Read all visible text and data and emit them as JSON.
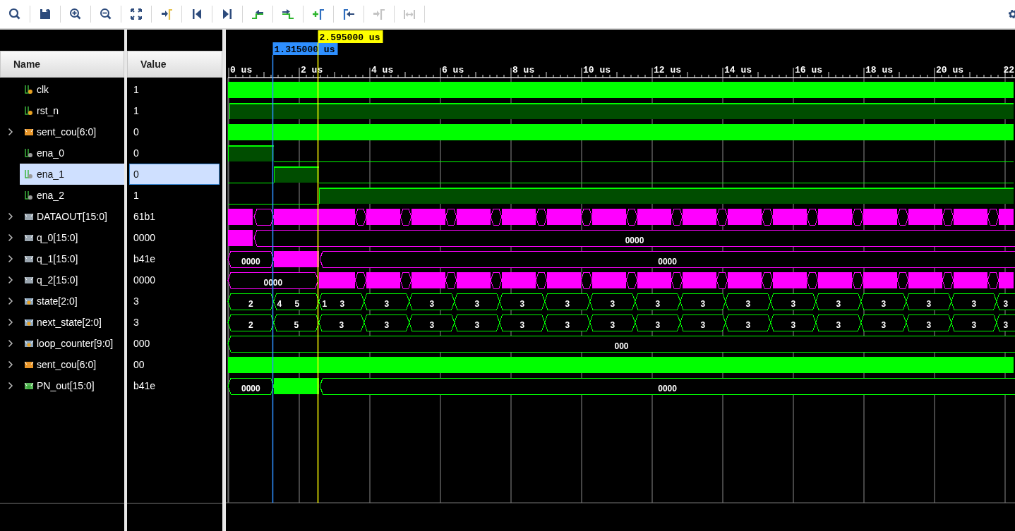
{
  "toolbar": [
    {
      "kind": "search",
      "disabled": false
    },
    {
      "kind": "save",
      "disabled": false
    },
    {
      "kind": "zoom_in",
      "disabled": false
    },
    {
      "kind": "zoom_out",
      "disabled": false
    },
    {
      "kind": "fit",
      "disabled": false
    },
    {
      "kind": "goto_cursor",
      "disabled": false
    },
    {
      "kind": "goto_start",
      "disabled": false
    },
    {
      "kind": "goto_end",
      "disabled": false
    },
    {
      "kind": "prev_transition",
      "disabled": false
    },
    {
      "kind": "next_transition",
      "disabled": false
    },
    {
      "kind": "add_marker",
      "disabled": false
    },
    {
      "kind": "prev_marker",
      "disabled": false
    },
    {
      "kind": "next_marker",
      "disabled": true
    },
    {
      "kind": "swap_cursors",
      "disabled": true
    },
    {
      "kind": "settings",
      "disabled": false
    }
  ],
  "columns": {
    "name": "Name",
    "value": "Value"
  },
  "cursors": [
    {
      "kind": "marker",
      "label": "1.315000 us"
    },
    {
      "kind": "cursor",
      "label": "2.595000 us"
    }
  ],
  "ruler": [
    "0 us",
    "2 us",
    "4 us",
    "6 us",
    "8 us",
    "10 us",
    "12 us",
    "14 us",
    "16 us",
    "18 us",
    "20 us",
    "22"
  ],
  "signals": [
    {
      "name": "clk",
      "value": "1",
      "kind": "input",
      "expandable": false,
      "selected": false,
      "color": "#00ff00"
    },
    {
      "name": "rst_n",
      "value": "1",
      "kind": "input",
      "expandable": false,
      "selected": false,
      "color": "#00ff00"
    },
    {
      "name": "sent_cou[6:0]",
      "value": "0",
      "kind": "constant",
      "expandable": true,
      "selected": false,
      "color": "#00ff00"
    },
    {
      "name": "ena_0",
      "value": "0",
      "kind": "wire",
      "expandable": false,
      "selected": false,
      "color": "#00ff00"
    },
    {
      "name": "ena_1",
      "value": "0",
      "kind": "wire",
      "expandable": false,
      "selected": true,
      "color": "#00ff00"
    },
    {
      "name": "ena_2",
      "value": "1",
      "kind": "wire",
      "expandable": false,
      "selected": false,
      "color": "#00ff00"
    },
    {
      "name": "DATAOUT[15:0]",
      "value": "61b1",
      "kind": "bus",
      "expandable": true,
      "selected": false,
      "color": "#ff00ff"
    },
    {
      "name": "q_0[15:0]",
      "value": "0000",
      "kind": "bus",
      "expandable": true,
      "selected": false,
      "color": "#ff00ff",
      "wave_values": [
        "0000"
      ]
    },
    {
      "name": "q_1[15:0]",
      "value": "b41e",
      "kind": "bus",
      "expandable": true,
      "selected": false,
      "color": "#ff00ff",
      "wave_values": [
        "0000",
        "0000"
      ]
    },
    {
      "name": "q_2[15:0]",
      "value": "0000",
      "kind": "bus",
      "expandable": true,
      "selected": false,
      "color": "#ff00ff",
      "wave_values": [
        "0000"
      ]
    },
    {
      "name": "state[2:0]",
      "value": "3",
      "kind": "register",
      "expandable": true,
      "selected": false,
      "color": "#00ff00",
      "wave_values": [
        "2",
        "4",
        "5",
        "1",
        "3",
        "3",
        "3",
        "3",
        "3",
        "3",
        "3",
        "3",
        "3",
        "3",
        "3",
        "3",
        "3",
        "3",
        "3",
        "3"
      ]
    },
    {
      "name": "next_state[2:0]",
      "value": "3",
      "kind": "register",
      "expandable": true,
      "selected": false,
      "color": "#00ff00",
      "wave_values": [
        "2",
        "5",
        "3",
        "3",
        "3",
        "3",
        "3",
        "3",
        "3",
        "3",
        "3",
        "3",
        "3",
        "3",
        "3",
        "3",
        "3",
        "3"
      ]
    },
    {
      "name": "loop_counter[9:0]",
      "value": "000",
      "kind": "register",
      "expandable": true,
      "selected": false,
      "color": "#00ff00",
      "wave_values": [
        "000"
      ]
    },
    {
      "name": "sent_cou[6:0]",
      "value": "00",
      "kind": "constant",
      "expandable": true,
      "selected": false,
      "color": "#00ff00"
    },
    {
      "name": "PN_out[15:0]",
      "value": "b41e",
      "kind": "output",
      "expandable": true,
      "selected": false,
      "color": "#00ff00",
      "wave_values": [
        "0000",
        "0000"
      ]
    }
  ]
}
